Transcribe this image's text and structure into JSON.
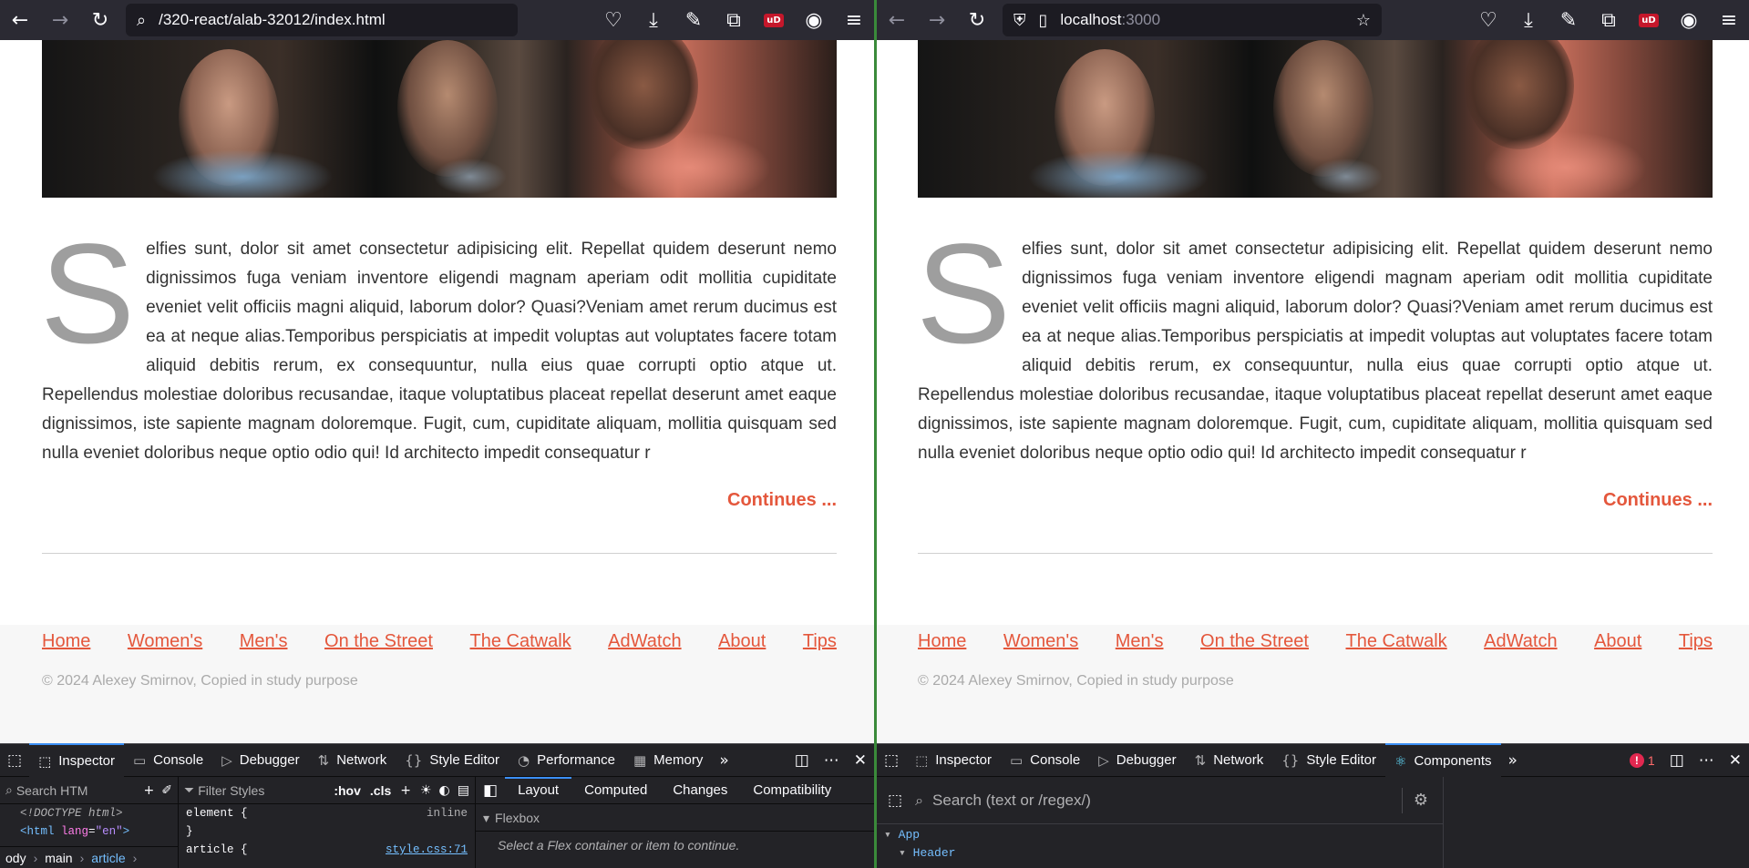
{
  "left_window": {
    "url": "/320-react/alab-32012/index.html"
  },
  "right_window": {
    "url_host": "localhost",
    "url_port": ":3000"
  },
  "page": {
    "dropcap": "S",
    "paragraph": "elfies sunt, dolor sit amet consectetur adipisicing elit. Repellat quidem deserunt nemo dignissimos fuga veniam inventore eligendi magnam aperiam odit mollitia cupiditate eveniet velit officiis magni aliquid, laborum dolor? Quasi?Veniam amet rerum ducimus est ea at neque alias.Temporibus perspiciatis at impedit voluptas aut voluptates facere totam aliquid debitis rerum, ex consequuntur, nulla eius quae corrupti optio atque ut. Repellendus molestiae doloribus recusandae, itaque voluptatibus placeat repellat deserunt amet eaque dignissimos, iste sapiente magnam doloremque. Fugit, cum, cupiditate aliquam, mollitia quisquam sed nulla eveniet doloribus neque optio odio qui! Id architecto impedit consequatur r",
    "continues": "Continues ...",
    "nav": [
      "Home",
      "Women's",
      "Men's",
      "On the Street",
      "The Catwalk",
      "AdWatch",
      "About",
      "Tips"
    ],
    "copyright": "© 2024 Alexey Smirnov, Copied in study purpose",
    "accent_color": "#e4573c"
  },
  "devtools_left": {
    "tabs": [
      "Inspector",
      "Console",
      "Debugger",
      "Network",
      "Style Editor",
      "Performance",
      "Memory"
    ],
    "search_placeholder": "Search HTM",
    "filter_placeholder": "Filter Styles",
    "hov": ":hov",
    "cls": ".cls",
    "html_lines": {
      "doctype": "<!DOCTYPE html>",
      "html_open": "<html",
      "lang_attr": "lang",
      "lang_val": "\"en\"",
      "close": ">"
    },
    "rules": {
      "element_selector": "element {",
      "element_source": "inline",
      "close_brace": "}",
      "article_selector": "article {",
      "article_source": "style.css:71"
    },
    "layout_tabs": [
      "Layout",
      "Computed",
      "Changes",
      "Compatibility"
    ],
    "flexbox_title": "Flexbox",
    "flexbox_hint": "Select a Flex container or item to continue.",
    "breadcrumbs": [
      "ody",
      "main",
      "article"
    ]
  },
  "devtools_right": {
    "tabs": [
      "Inspector",
      "Console",
      "Debugger",
      "Network",
      "Style Editor",
      "Components"
    ],
    "error_count": "1",
    "search_placeholder": "Search (text or /regex/)",
    "tree": [
      "App",
      "Header"
    ]
  }
}
